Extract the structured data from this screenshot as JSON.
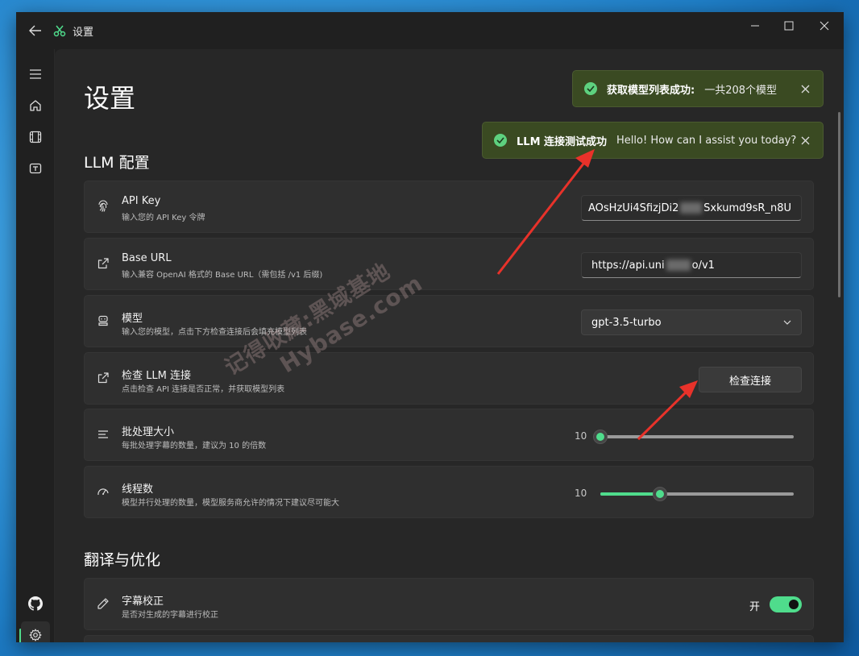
{
  "window": {
    "title": "设置",
    "back_icon": "arrow-left-icon",
    "app_icon": "scissors-icon",
    "controls": [
      "minimize",
      "maximize",
      "close"
    ]
  },
  "sidebar": {
    "items": [
      {
        "name": "menu",
        "icon": "hamburger-icon"
      },
      {
        "name": "home",
        "icon": "home-icon"
      },
      {
        "name": "video",
        "icon": "film-icon"
      },
      {
        "name": "subtitle",
        "icon": "text-box-icon"
      }
    ],
    "bottom_items": [
      {
        "name": "github",
        "icon": "github-icon"
      },
      {
        "name": "settings",
        "icon": "gear-icon",
        "active": true
      }
    ]
  },
  "page": {
    "title": "设置",
    "section_llm": "LLM 配置",
    "section_translate": "翻译与优化"
  },
  "settings": {
    "api_key": {
      "title": "API Key",
      "desc": "输入您的 API Key 令牌",
      "value_start": "AOsHzUi4SfizjDi2",
      "value_end": "Sxkumd9sR_n8U"
    },
    "base_url": {
      "title": "Base URL",
      "desc": "输入兼容 OpenAI 格式的 Base URL（需包括 /v1 后缀)",
      "value_start": "https://api.uni",
      "value_end": "o/v1"
    },
    "model": {
      "title": "模型",
      "desc": "输入您的模型，点击下方检查连接后会填充模型列表",
      "selected": "gpt-3.5-turbo"
    },
    "check": {
      "title": "检查 LLM 连接",
      "desc": "点击检查 API 连接是否正常，并获取模型列表",
      "button": "检查连接"
    },
    "batch": {
      "title": "批处理大小",
      "desc": "每批处理字幕的数量，建议为 10 的倍数",
      "value": "10",
      "fraction": 0.0
    },
    "threads": {
      "title": "线程数",
      "desc": "模型并行处理的数量，模型服务商允许的情况下建议尽可能大",
      "value": "10",
      "fraction": 0.31
    },
    "correction": {
      "title": "字幕校正",
      "desc": "是否对生成的字幕进行校正",
      "state_label": "开",
      "enabled": true
    }
  },
  "toasts": [
    {
      "title": "获取模型列表成功:",
      "message": "一共208个模型"
    },
    {
      "title": "LLM 连接测试成功",
      "message": "Hello! How can I assist you today?"
    }
  ],
  "watermark": {
    "line1": "记得收藏:黑域基地",
    "line2": "Hybase.com"
  },
  "colors": {
    "accent": "#4fdc8c",
    "toast_bg": "#3a4a22",
    "annotation_arrow": "#e8322a"
  }
}
